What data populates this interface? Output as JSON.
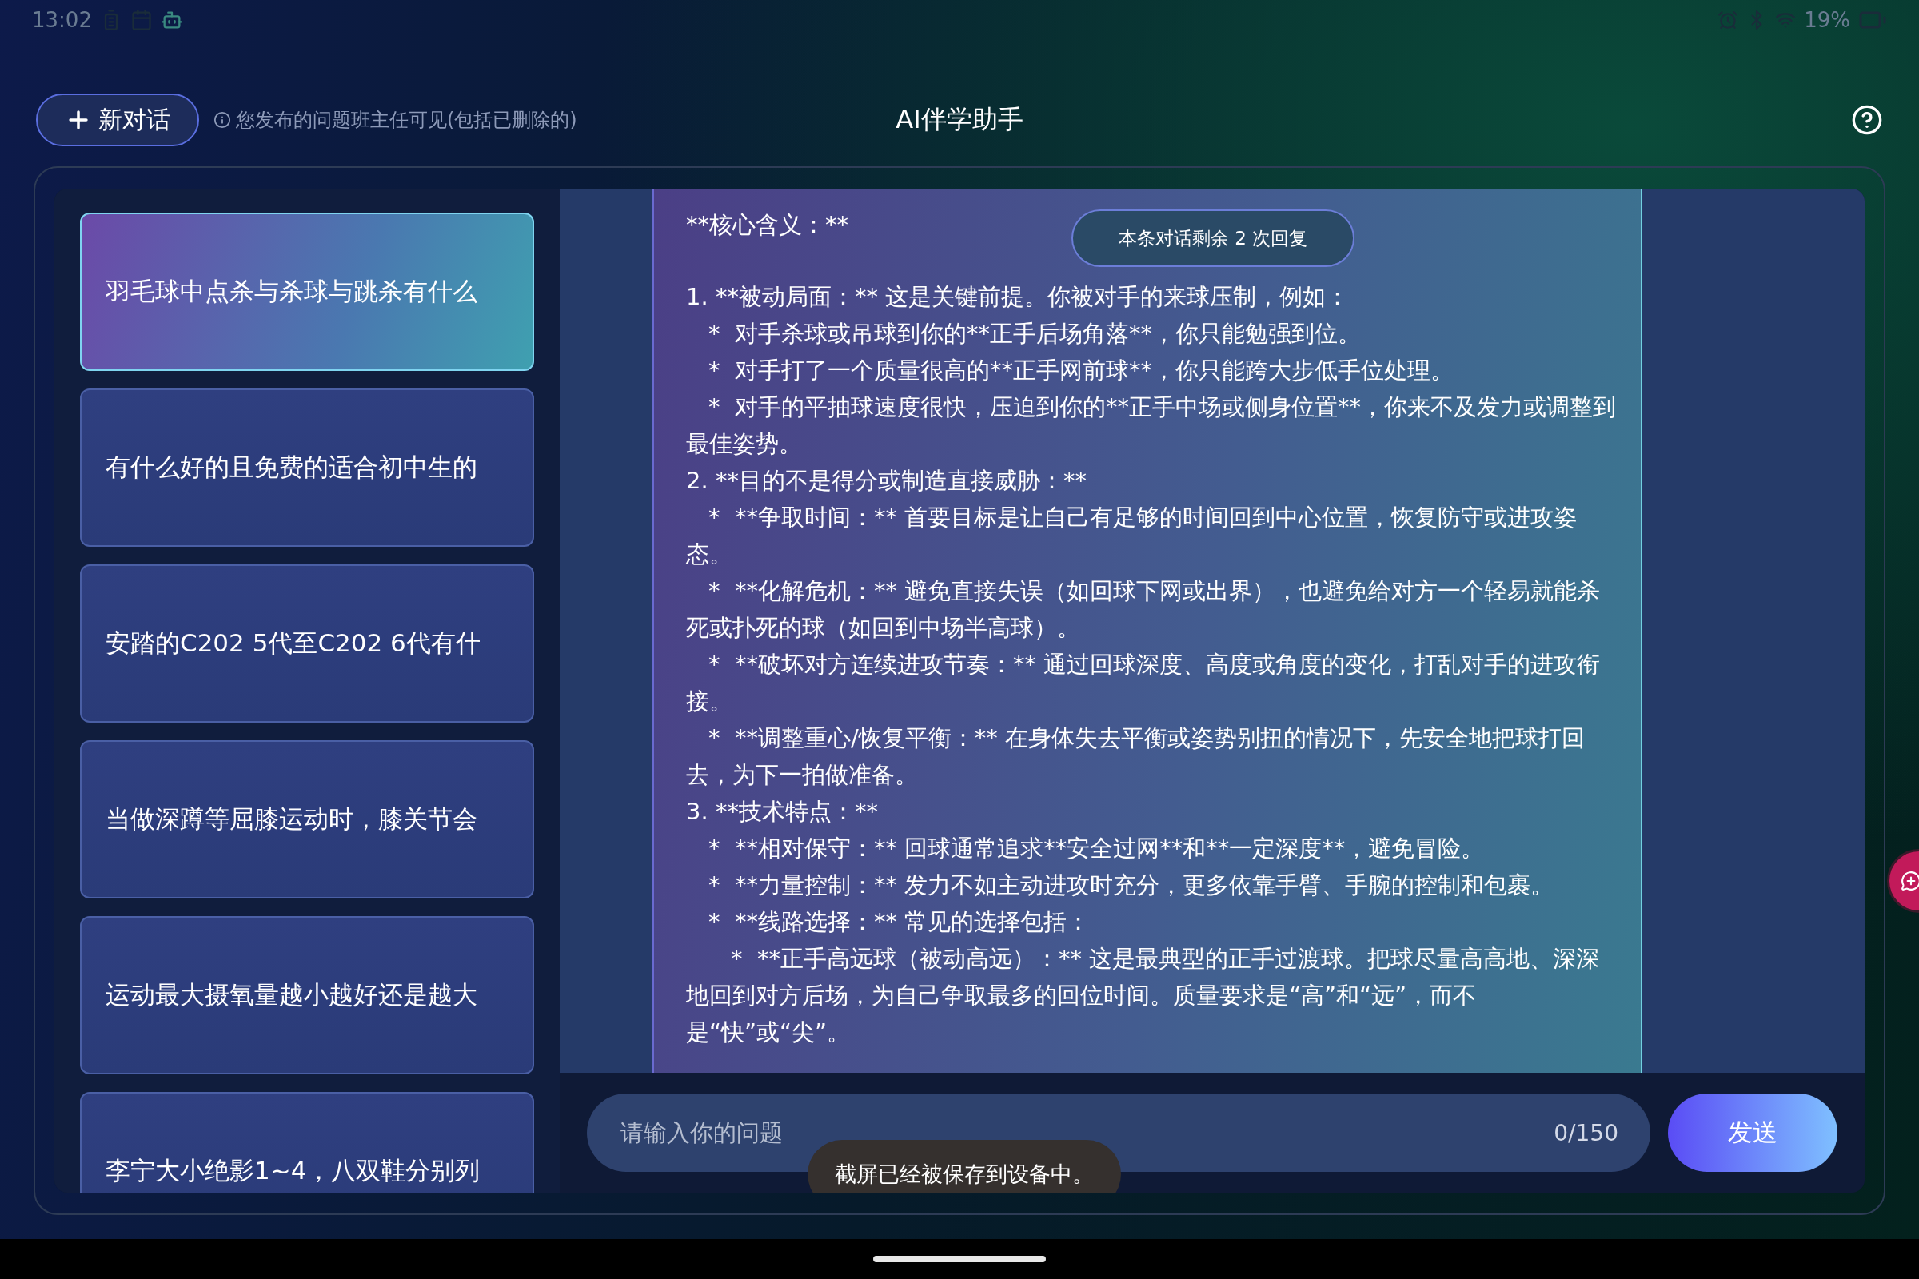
{
  "status_bar": {
    "time": "13:02",
    "battery": "19%"
  },
  "header": {
    "new_chat_label": "新对话",
    "notice": "您发布的问题班主任可见(包括已删除的)",
    "title": "AI伴学助手"
  },
  "conversations": [
    {
      "title": "羽毛球中点杀与杀球与跳杀有什么",
      "selected": true
    },
    {
      "title": "有什么好的且免费的适合初中生的",
      "selected": false
    },
    {
      "title": "安踏的C202 5代至C202 6代有什",
      "selected": false
    },
    {
      "title": "当做深蹲等屈膝运动时，膝关节会",
      "selected": false
    },
    {
      "title": "运动最大摄氧量越小越好还是越大",
      "selected": false
    },
    {
      "title": "李宁大小绝影1~4，八双鞋分别列",
      "selected": false
    }
  ],
  "chat": {
    "remaining_badge": "本条对话剩余 2 次回复",
    "message": {
      "heading": "**核心含义：**",
      "items": [
        {
          "text": "1. **被动局面：** 这是关键前提。你被对手的来球压制，例如：",
          "children": [
            {
              "text": "*  对手杀球或吊球到你的**正手后场角落**，你只能勉强到位。"
            },
            {
              "text": "*  对手打了一个质量很高的**正手网前球**，你只能跨大步低手位处理。"
            },
            {
              "text": "*  对手的平抽球速度很快，压迫到你的**正手中场或侧身位置**，你来不及发力或调整到最佳姿势。"
            }
          ]
        },
        {
          "text": "2. **目的不是得分或制造直接威胁：**",
          "children": [
            {
              "text": "*  **争取时间：** 首要目标是让自己有足够的时间回到中心位置，恢复防守或进攻姿态。"
            },
            {
              "text": "*  **化解危机：** 避免直接失误（如回球下网或出界），也避免给对方一个轻易就能杀死或扑死的球（如回到中场半高球）。"
            },
            {
              "text": "*  **破坏对方连续进攻节奏：** 通过回球深度、高度或角度的变化，打乱对手的进攻衔接。"
            },
            {
              "text": "*  **调整重心/恢复平衡：** 在身体失去平衡或姿势别扭的情况下，先安全地把球打回去，为下一拍做准备。"
            }
          ]
        },
        {
          "text": "3. **技术特点：**",
          "children": [
            {
              "text": "*  **相对保守：** 回球通常追求**安全过网**和**一定深度**，避免冒险。"
            },
            {
              "text": "*  **力量控制：** 发力不如主动进攻时充分，更多依靠手臂、手腕的控制和包裹。"
            },
            {
              "text": "*  **线路选择：** 常见的选择包括：",
              "children": [
                {
                  "text": "*  **正手高远球（被动高远）：** 这是最典型的正手过渡球。把球尽量高高地、深深地回到对方后场，为自己争取最多的回位时间。质量要求是“高”和“远”，而不",
                  "continuation": "是“快”或“尖”。"
                }
              ]
            }
          ]
        }
      ]
    }
  },
  "input": {
    "placeholder": "请输入你的问题",
    "counter": "0/150",
    "send_label": "发送"
  },
  "toast": "截屏已经被保存到设备中。"
}
